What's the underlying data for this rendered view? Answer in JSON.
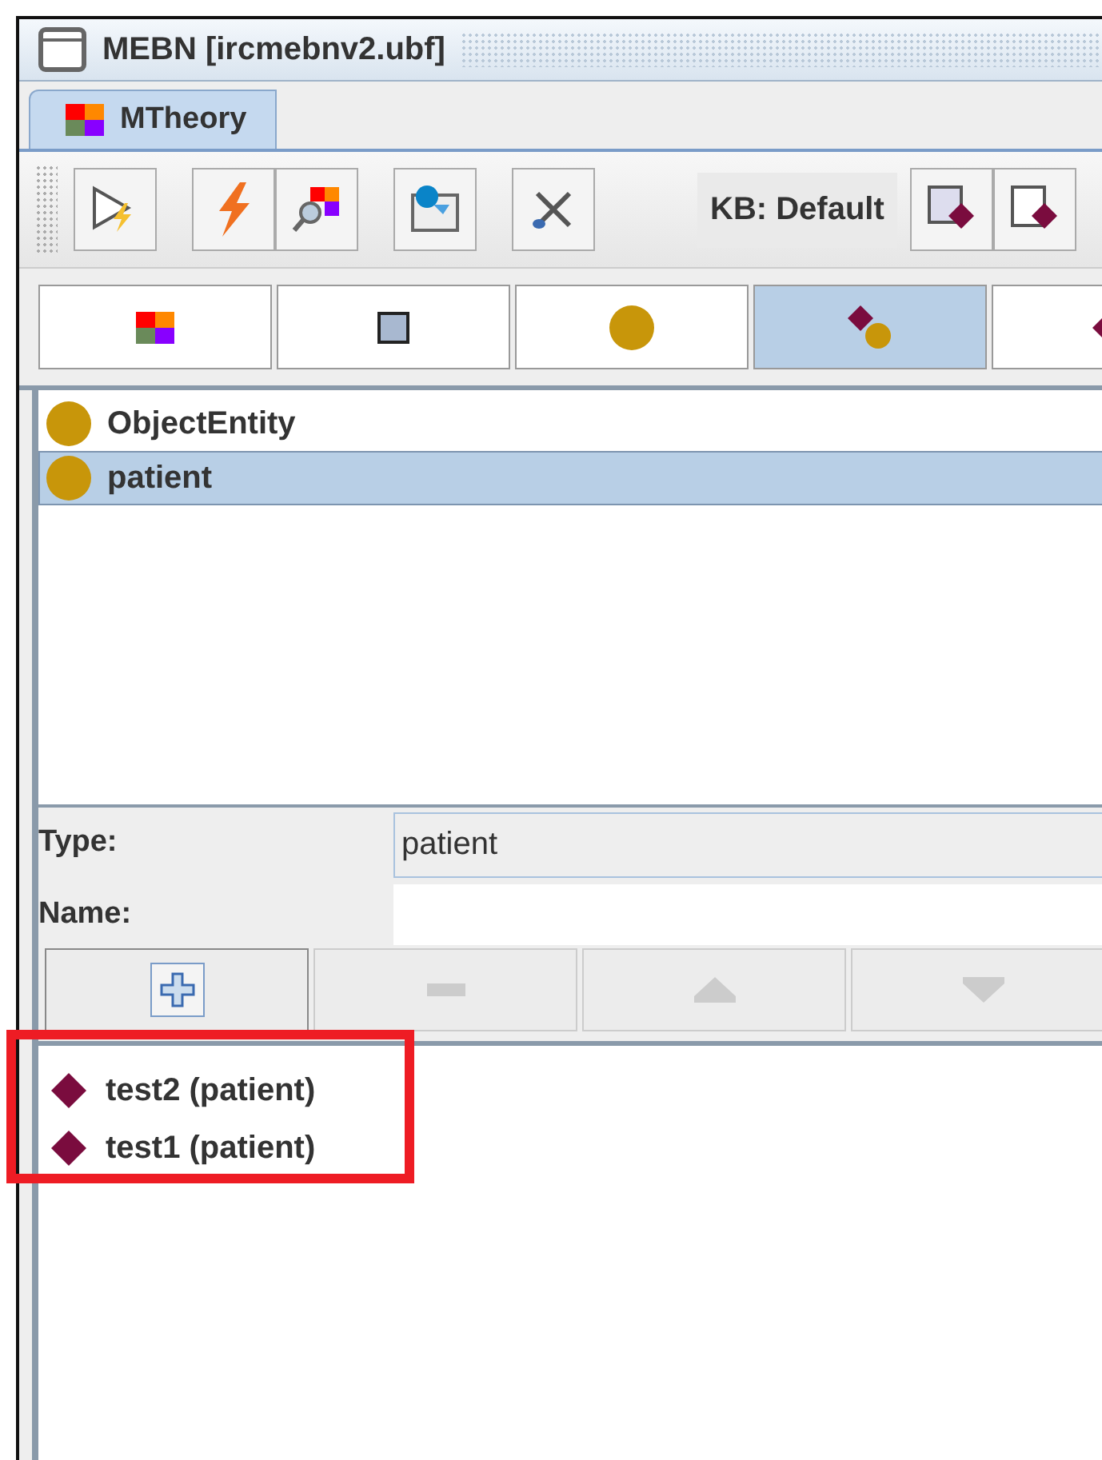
{
  "window": {
    "title": "MEBN [ircmebnv2.ubf]"
  },
  "tabs": [
    {
      "label": "MTheory",
      "selected": true
    }
  ],
  "toolbar": {
    "kb_label": "KB: Default"
  },
  "mode_tabs": [
    {
      "kind": "mtheory",
      "selected": false
    },
    {
      "kind": "node",
      "selected": false
    },
    {
      "kind": "entity",
      "selected": false
    },
    {
      "kind": "instance",
      "selected": true
    },
    {
      "kind": "finding",
      "selected": false
    }
  ],
  "entities": [
    {
      "name": "ObjectEntity",
      "selected": false
    },
    {
      "name": "patient",
      "selected": true
    }
  ],
  "form": {
    "type_label": "Type:",
    "type_value": "patient",
    "name_label": "Name:"
  },
  "edit_buttons": [
    {
      "kind": "add",
      "disabled": false
    },
    {
      "kind": "remove",
      "disabled": true
    },
    {
      "kind": "up",
      "disabled": true
    },
    {
      "kind": "down",
      "disabled": true
    }
  ],
  "instances": [
    {
      "name": "test2 (patient)"
    },
    {
      "name": "test1 (patient)"
    }
  ],
  "highlight": {
    "on": true
  }
}
